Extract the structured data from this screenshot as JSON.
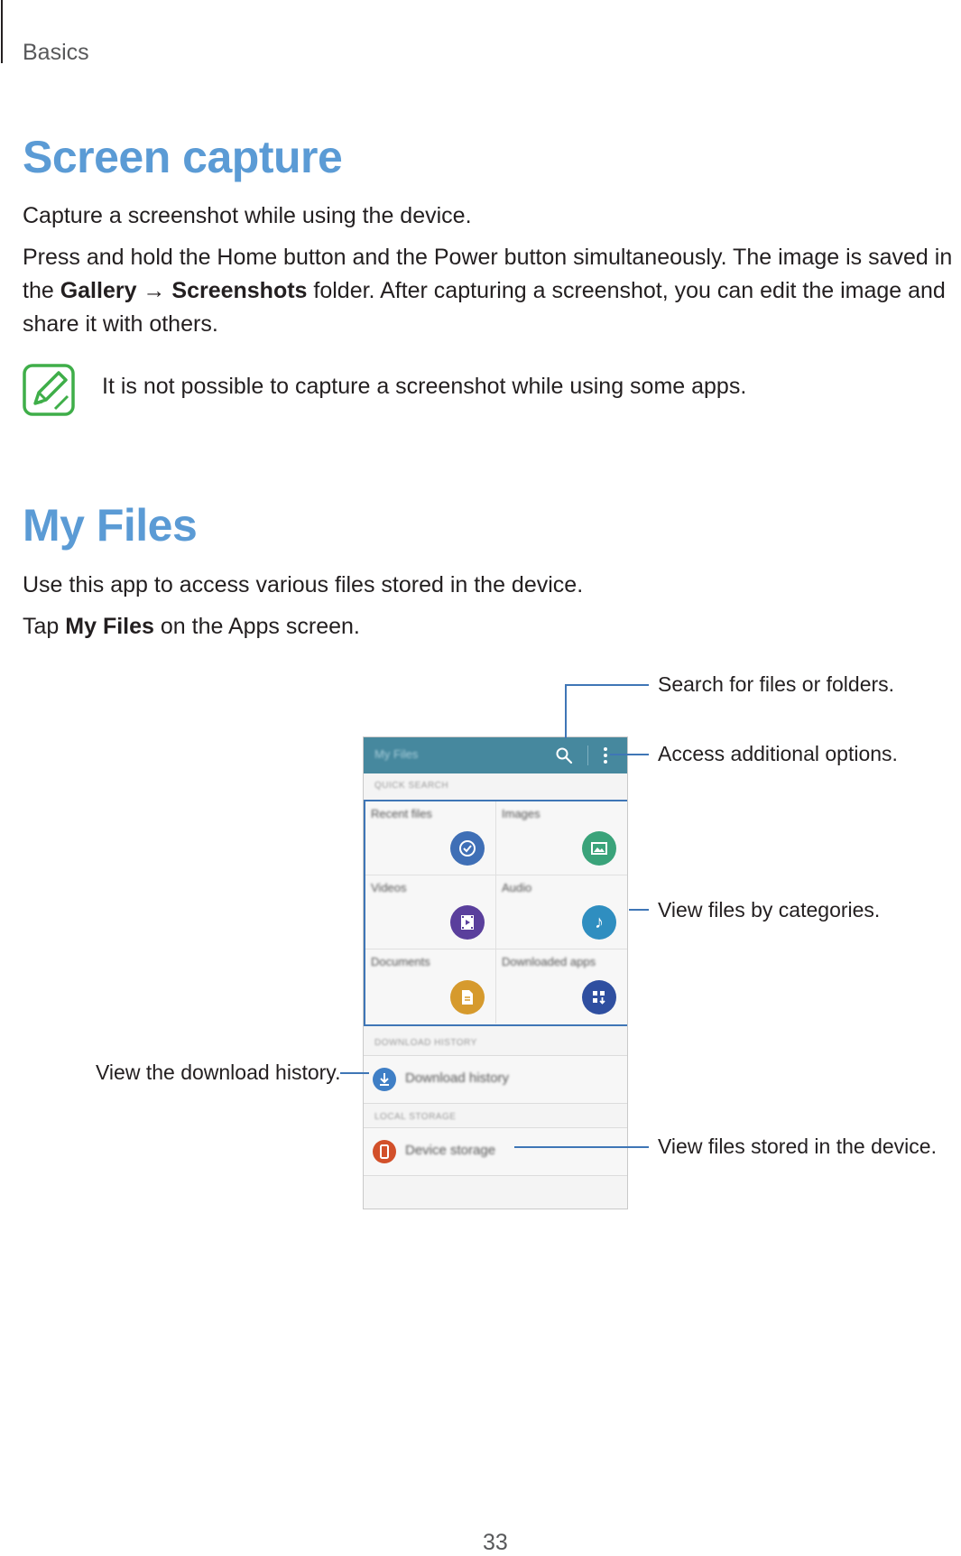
{
  "header": {
    "section": "Basics"
  },
  "screen_capture": {
    "title": "Screen capture",
    "intro": "Capture a screenshot while using the device.",
    "line1": "Press and hold the Home button and the Power button simultaneously. The image is saved in",
    "line2_pre": "the ",
    "gallery": "Gallery",
    "arrow": " → ",
    "screenshots": "Screenshots",
    "line2_post": " folder. After capturing a screenshot, you can edit the image and",
    "line3": "share it with others.",
    "note": "It is not possible to capture a screenshot while using some apps."
  },
  "my_files": {
    "title": "My Files",
    "intro": "Use this app to access various files stored in the device.",
    "tap_pre": "Tap ",
    "tap_bold": "My Files",
    "tap_post": " on the Apps screen."
  },
  "phone": {
    "app_title": "My Files",
    "quick_search": "Quick search",
    "categories": [
      {
        "label": "Recent files",
        "icon": "clock-check-icon",
        "color": "#3f6fb6"
      },
      {
        "label": "Images",
        "icon": "image-icon",
        "color": "#3aa37a"
      },
      {
        "label": "Videos",
        "icon": "film-icon",
        "color": "#5a3f9c"
      },
      {
        "label": "Audio",
        "icon": "music-note-icon",
        "color": "#2f8ec0"
      },
      {
        "label": "Documents",
        "icon": "document-icon",
        "color": "#d69a2d"
      },
      {
        "label": "Downloaded apps",
        "icon": "apps-download-icon",
        "color": "#2f4fa0"
      }
    ],
    "download_history_section": "Download history",
    "download_history": "Download history",
    "local_storage_section": "Local storage",
    "device_storage": "Device storage",
    "colors": {
      "appbar": "#46889e",
      "highlight": "#3f76b6",
      "download": "#3f7fc6",
      "storage": "#d2502a"
    }
  },
  "callouts": {
    "search": "Search for files or folders.",
    "options": "Access additional options.",
    "categories": "View files by categories.",
    "download": "View the download history.",
    "storage": "View files stored in the device."
  },
  "footer": {
    "page_number": "33"
  }
}
